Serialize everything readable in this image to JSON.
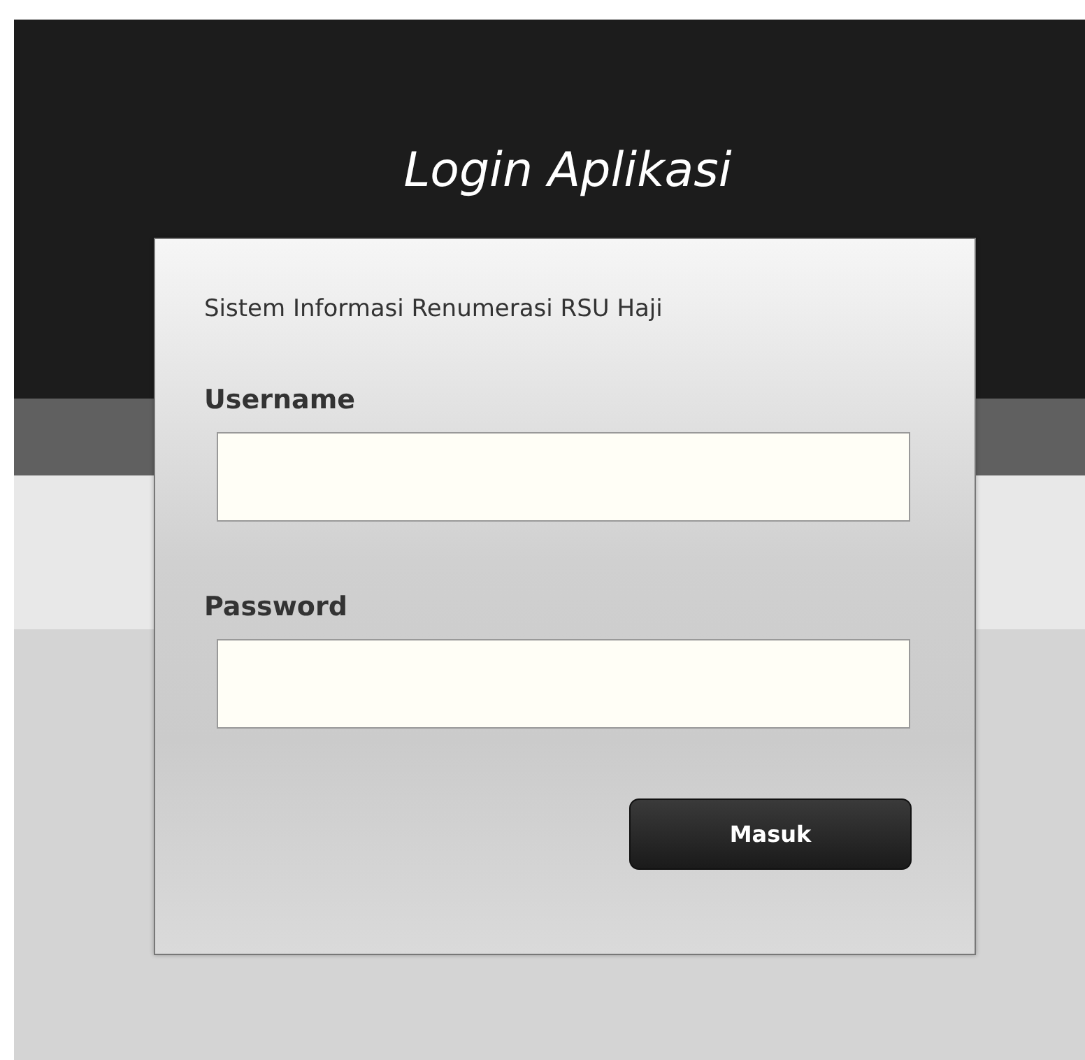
{
  "title": "Login Aplikasi",
  "subtitle": "Sistem Informasi Renumerasi RSU Haji",
  "fields": [
    {
      "label": "Username"
    },
    {
      "label": "Password"
    }
  ],
  "buttons": [
    "Masuk"
  ]
}
